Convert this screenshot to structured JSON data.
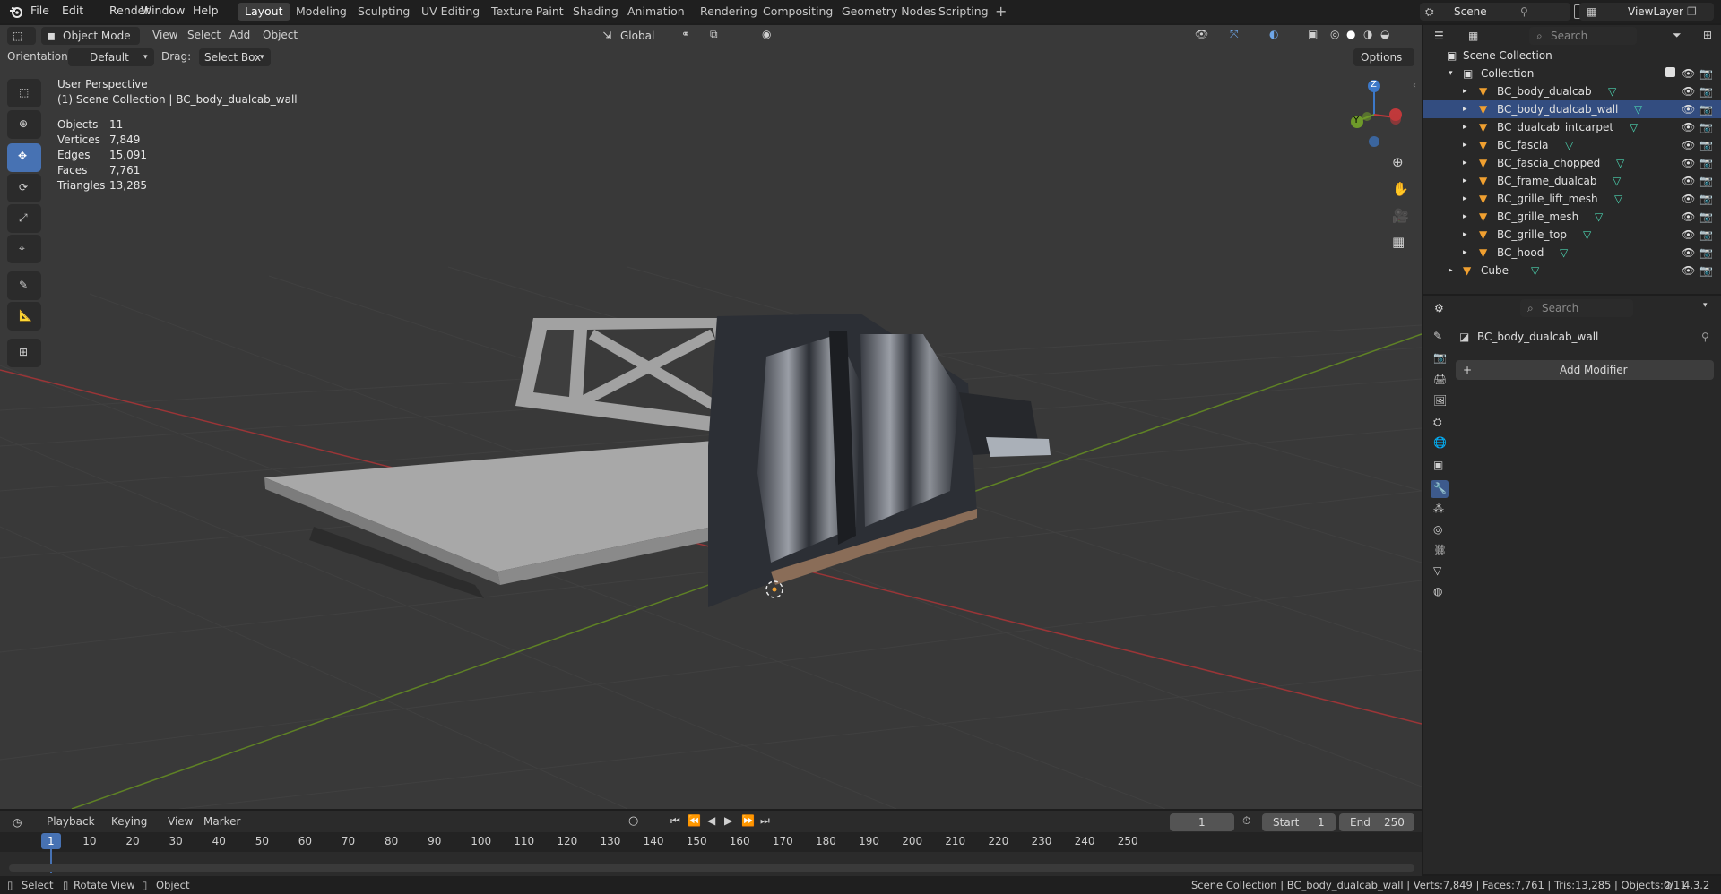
{
  "menu": {
    "items": [
      "File",
      "Edit",
      "Render",
      "Window",
      "Help"
    ],
    "workspaces": [
      "Layout",
      "Modeling",
      "Sculpting",
      "UV Editing",
      "Texture Paint",
      "Shading",
      "Animation",
      "Rendering",
      "Compositing",
      "Geometry Nodes",
      "Scripting"
    ],
    "active_workspace": "Layout",
    "scene": "Scene",
    "view_layer": "ViewLayer"
  },
  "viewport_header": {
    "mode": "Object Mode",
    "menus": [
      "View",
      "Select",
      "Add",
      "Object"
    ],
    "transform_orientation": "Global",
    "orientation_label": "Orientation:",
    "orientation_value": "Default",
    "drag_label": "Drag:",
    "drag_value": "Select Box",
    "options_label": "Options"
  },
  "viewport": {
    "view_name": "User Perspective",
    "context": "(1) Scene Collection | BC_body_dualcab_wall",
    "stats": [
      {
        "label": "Objects",
        "value": "11"
      },
      {
        "label": "Vertices",
        "value": "7,849"
      },
      {
        "label": "Edges",
        "value": "15,091"
      },
      {
        "label": "Faces",
        "value": "7,761"
      },
      {
        "label": "Triangles",
        "value": "13,285"
      }
    ],
    "gizmo": {
      "x": "X",
      "y": "Y",
      "z": "Z"
    },
    "colors": {
      "x_axis": "#c0393b",
      "y_axis": "#6e9a2a",
      "z_axis": "#3c78c8",
      "accent": "#4772b3"
    }
  },
  "timeline": {
    "menus": [
      "Playback",
      "Keying",
      "View",
      "Marker"
    ],
    "current_frame": "1",
    "start_label": "Start",
    "start_value": "1",
    "end_label": "End",
    "end_value": "250",
    "ruler": [
      "1",
      "10",
      "20",
      "30",
      "40",
      "50",
      "60",
      "70",
      "80",
      "90",
      "100",
      "110",
      "120",
      "130",
      "140",
      "150",
      "160",
      "170",
      "180",
      "190",
      "200",
      "210",
      "220",
      "230",
      "240",
      "250"
    ]
  },
  "statusbar": {
    "select": "Select",
    "rotate": "Rotate View",
    "object": "Object",
    "info": "Scene Collection | BC_body_dualcab_wall | Verts:7,849 | Faces:7,761 | Tris:13,285 | Objects:0/11",
    "version": "4.3.2"
  },
  "outliner": {
    "search_placeholder": "Search",
    "root": "Scene Collection",
    "collection": "Collection",
    "items": [
      {
        "name": "BC_body_dualcab",
        "selected": false
      },
      {
        "name": "BC_body_dualcab_wall",
        "selected": true
      },
      {
        "name": "BC_dualcab_intcarpet",
        "selected": false
      },
      {
        "name": "BC_fascia",
        "selected": false
      },
      {
        "name": "BC_fascia_chopped",
        "selected": false
      },
      {
        "name": "BC_frame_dualcab",
        "selected": false
      },
      {
        "name": "BC_grille_lift_mesh",
        "selected": false
      },
      {
        "name": "BC_grille_mesh",
        "selected": false
      },
      {
        "name": "BC_grille_top",
        "selected": false
      },
      {
        "name": "BC_hood",
        "selected": false
      }
    ],
    "extra": "Cube"
  },
  "properties": {
    "search_placeholder": "Search",
    "object_name": "BC_body_dualcab_wall",
    "add_modifier": "Add Modifier",
    "tabs": [
      "tool-icon",
      "render-icon",
      "output-icon",
      "view-layer-icon",
      "scene-icon",
      "world-icon",
      "object-icon",
      "modifier-icon",
      "particles-icon",
      "physics-icon",
      "constraints-icon",
      "data-icon",
      "material-icon"
    ],
    "active_tab": "modifier-icon"
  }
}
